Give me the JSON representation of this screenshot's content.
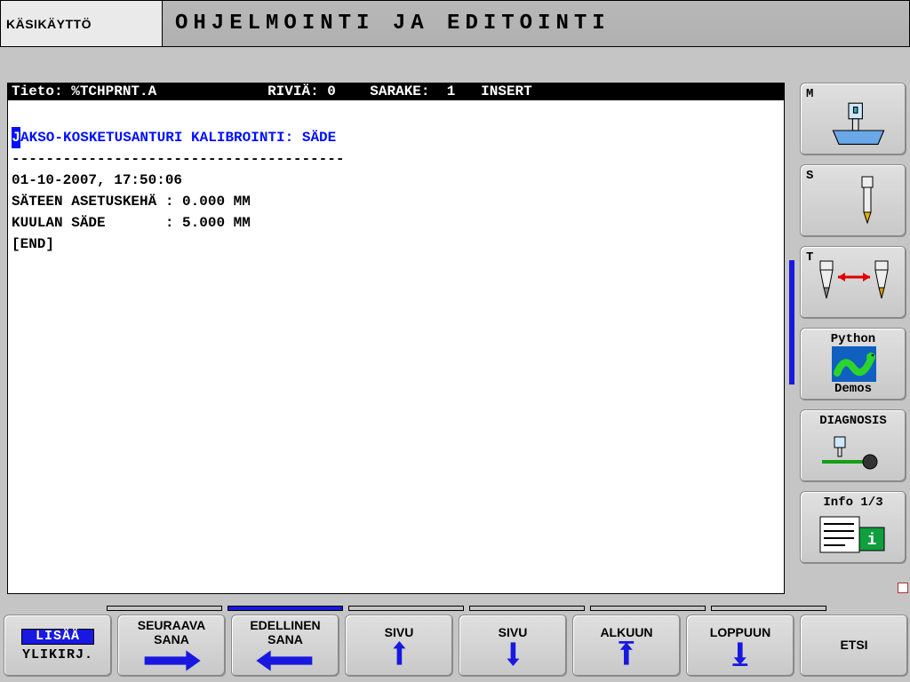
{
  "header": {
    "mode_tab": "KÄSIKÄYTTÖ",
    "title": "OHJELMOINTI JA EDITOINTI"
  },
  "editor": {
    "status": {
      "tieto_label": "Tieto:",
      "tieto_value": "%TCHPRNT.A",
      "rivia_label": "RIVIÄ:",
      "rivia_value": "0",
      "sarake_label": "SARAKE:",
      "sarake_value": "1",
      "mode": "INSERT"
    },
    "lines": {
      "l1_first": "J",
      "l1_rest": "AKSO-KOSKETUSANTURI KALIBROINTI: SÄDE",
      "l2": "---------------------------------------",
      "l3": "01-10-2007, 17:50:06",
      "l4": "SÄTEEN ASETUSKEHÄ : 0.000 MM",
      "l5": "KUULAN SÄDE       : 5.000 MM",
      "l6": "[END]"
    }
  },
  "vkeys": {
    "m": "M",
    "s": "S",
    "t": "T",
    "python_top": "Python",
    "python_bot": "Demos",
    "diagnosis": "DIAGNOSIS",
    "info": "Info 1/3"
  },
  "hkeys": {
    "k1_sel": "LISÄÄ",
    "k1_alt": "YLIKIRJ.",
    "k2a": "SEURAAVA",
    "k2b": "SANA",
    "k3a": "EDELLINEN",
    "k3b": "SANA",
    "k4": "SIVU",
    "k5": "SIVU",
    "k6": "ALKUUN",
    "k7": "LOPPUUN",
    "k8": "ETSI"
  },
  "pager": {
    "active": 1,
    "total": 6
  }
}
